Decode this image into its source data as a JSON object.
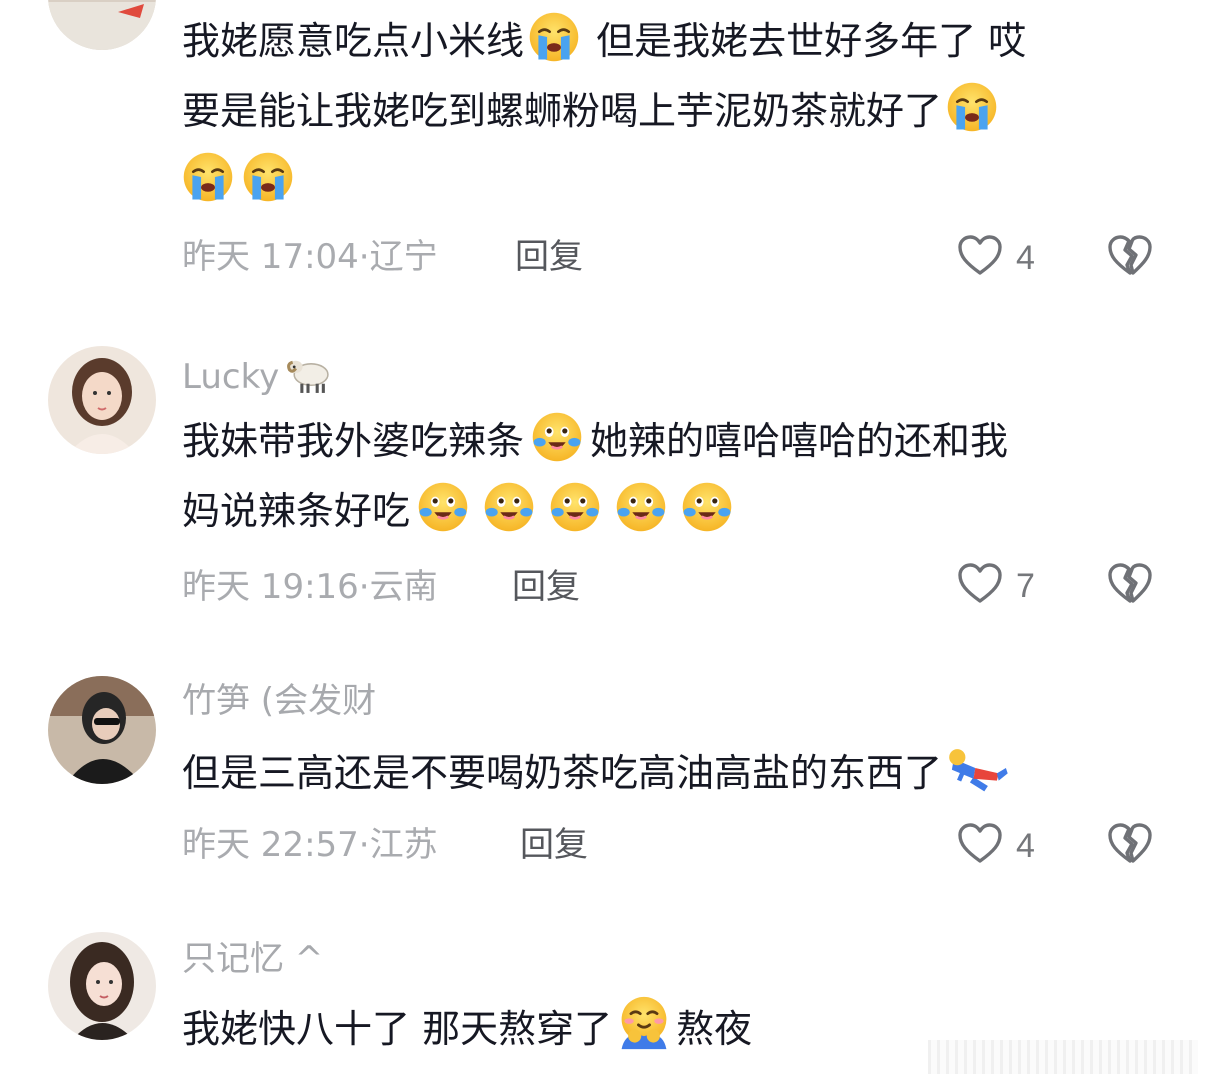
{
  "comments": [
    {
      "username": "",
      "text_lines": [
        "我姥愿意吃点小米线",
        " 但是我姥去世好多年了 哎",
        "要是能让我姥吃到螺蛳粉喝上芋泥奶茶就好了"
      ],
      "time": "昨天 17:04",
      "location": "辽宁",
      "reply_label": "回复",
      "likes": "4"
    },
    {
      "username": "Lucky",
      "username_emoji": "ram-emoji",
      "text_lines": [
        "我妹带我外婆吃辣条",
        "她辣的嘻哈嘻哈的还和我",
        "妈说辣条好吃"
      ],
      "time": "昨天 19:16",
      "location": "云南",
      "reply_label": "回复",
      "likes": "7"
    },
    {
      "username": "竹笋 (会发财",
      "text_lines": [
        "但是三高还是不要喝奶茶吃高油高盐的东西了"
      ],
      "time": "昨天 22:57",
      "location": "江苏",
      "reply_label": "回复",
      "likes": "4"
    },
    {
      "username": "只记忆 ^",
      "text_lines": [
        "我姥快八十了 那天熬穿了",
        "熬夜"
      ],
      "time": "",
      "location": "",
      "reply_label": "",
      "likes": ""
    }
  ],
  "separator": "·",
  "icons": {
    "like": "heart-outline-icon",
    "dislike": "broken-heart-icon",
    "emoji_crying": "loudly-crying-face-emoji",
    "emoji_tears_joy": "face-with-tears-emoji",
    "emoji_fallen": "fallen-person-emoji",
    "emoji_hug": "hugging-face-emoji"
  },
  "colors": {
    "username": "#a7a9ad",
    "meta": "#a9abaf",
    "reply": "#55575c",
    "text": "#161823",
    "icon": "#6f7176"
  }
}
